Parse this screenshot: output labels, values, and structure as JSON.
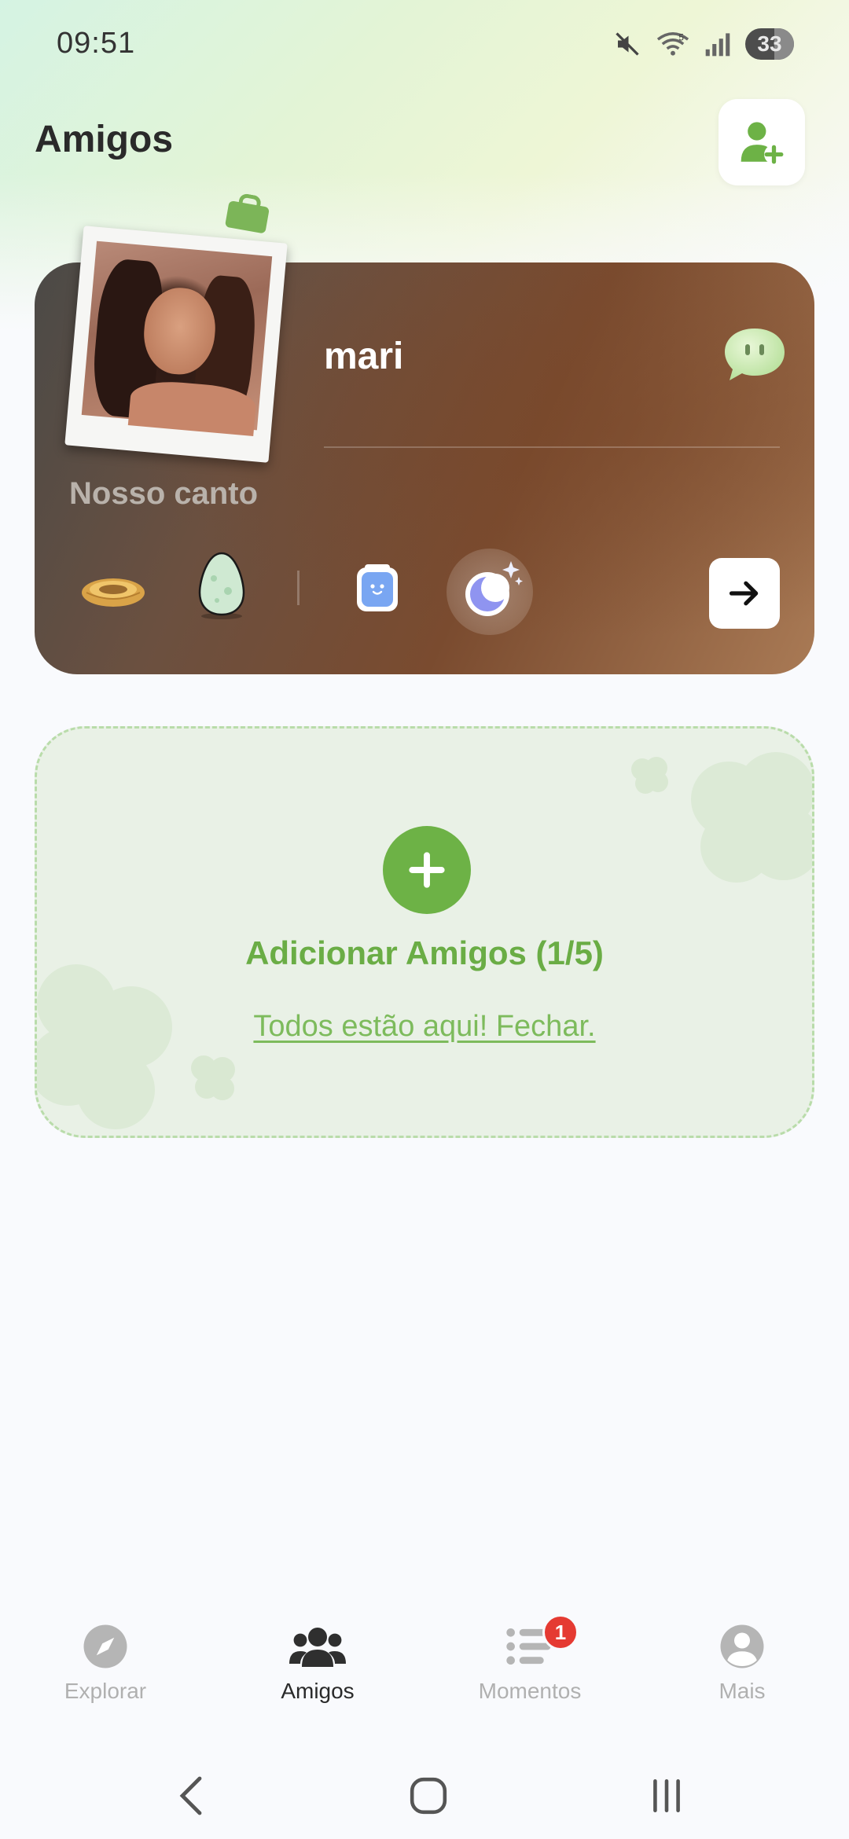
{
  "status_bar": {
    "time": "09:51",
    "battery": "33",
    "icons": [
      "mute-icon",
      "wifi-icon",
      "signal-icon",
      "battery-icon"
    ]
  },
  "header": {
    "title": "Amigos",
    "add_friend_icon": "add-user-icon"
  },
  "friend_card": {
    "name": "mari",
    "corner_label": "Nosso canto",
    "items": [
      "nest-icon",
      "egg-icon",
      "jar-icon",
      "moon-icon"
    ],
    "open_icon": "arrow-right-icon",
    "chat_icon": "chat-bubble-icon"
  },
  "add_panel": {
    "title": "Adicionar Amigos (1/5)",
    "close_link": "Todos estão aqui! Fechar."
  },
  "bottom_nav": {
    "items": [
      {
        "label": "Explorar",
        "icon": "compass-icon",
        "active": false
      },
      {
        "label": "Amigos",
        "icon": "friends-icon",
        "active": true
      },
      {
        "label": "Momentos",
        "icon": "moments-icon",
        "active": false,
        "badge": "1"
      },
      {
        "label": "Mais",
        "icon": "profile-icon",
        "active": false
      }
    ]
  },
  "colors": {
    "accent": "#6db246",
    "card_brown": "#7a4b2f",
    "badge_red": "#e53a32"
  }
}
